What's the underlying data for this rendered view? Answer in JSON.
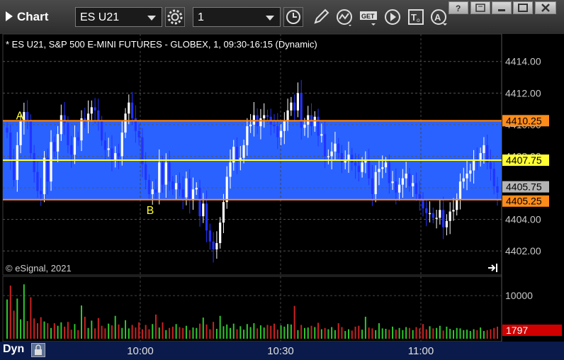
{
  "window": {
    "title": "Chart",
    "symbol": "ES U21",
    "interval": "1"
  },
  "chart_header": "* ES U21, S&P 500 E-MINI FUTURES - GLOBEX, 1, 09:30-16:15 (Dynamic)",
  "copyright": "© eSignal, 2021",
  "footer": {
    "mode_label": "Dyn"
  },
  "icons": {
    "settings": "gear-icon",
    "time": "clock-icon",
    "draw": "pencil-icon",
    "study": "study-line-icon",
    "get": "get-data-icon",
    "play": "play-icon",
    "text": "text-tool-icon",
    "alert": "alert-icon"
  },
  "colors": {
    "band": "#2a62ff",
    "level_line": "#ff8c1a",
    "mid_line": "#ffff33",
    "up_candle": "#ffffff",
    "down_candle": "#2233ff",
    "volume_up": "#2fc62f",
    "volume_down": "#cc2222"
  },
  "chart_data": {
    "type": "candlestick",
    "title": "* ES U21, S&P 500 E-MINI FUTURES - GLOBEX, 1, 09:30-16:15 (Dynamic)",
    "y_axis": {
      "ticks": [
        "4414.00",
        "4412.00",
        "4410.00",
        "4408.00",
        "4406.00",
        "4404.00",
        "4402.00"
      ],
      "range": [
        4401.2,
        4415.2
      ]
    },
    "x_axis": {
      "ticks": [
        "10:00",
        "10:30",
        "11:00"
      ]
    },
    "price_labels": [
      {
        "text": "4410.25",
        "value": 4410.25,
        "color": "#ff8c1a"
      },
      {
        "text": "4407.75",
        "value": 4407.75,
        "color": "#ffff33"
      },
      {
        "text": "4405.75",
        "value": 4405.75,
        "color": "#b4b4b4"
      },
      {
        "text": "4405.25",
        "value": 4405.25,
        "color": "#ff8c1a"
      }
    ],
    "band": {
      "top": 4410.25,
      "bottom": 4405.25,
      "mid": 4407.75
    },
    "annotations": [
      {
        "text": "A",
        "value": 4410.6
      },
      {
        "text": "B",
        "value": 4404.6
      }
    ],
    "last_close": 4405.75,
    "closes": [
      4409.5,
      4407.8,
      4406.5,
      4408.7,
      4410.2,
      4410.8,
      4410.3,
      4408.2,
      4407.0,
      4405.8,
      4405.6,
      4407.9,
      4406.4,
      4408.9,
      4408.3,
      4409.4,
      4410.6,
      4410.1,
      4408.7,
      4408.1,
      4409.2,
      4409.0,
      4410.4,
      4410.2,
      4410.7,
      4411.1,
      4410.9,
      4410.2,
      4409.0,
      4408.4,
      4408.5,
      4407.8,
      4408.2,
      4408.0,
      4409.5,
      4410.7,
      4411.4,
      4410.4,
      4409.6,
      4409.2,
      4407.5,
      4406.5,
      4405.6,
      4405.9,
      4405.7,
      4407.6,
      4406.2,
      4407.6,
      4406.4,
      4405.9,
      4406.3,
      4405.9,
      4405.4,
      4406.6,
      4405.2,
      4405.9,
      4406.0,
      4404.2,
      4405.0,
      4403.3,
      4402.6,
      4402.1,
      4402.5,
      4403.8,
      4405.1,
      4406.7,
      4407.6,
      4408.6,
      4407.7,
      4407.9,
      4408.7,
      4409.9,
      4410.0,
      4410.6,
      4409.9,
      4410.4,
      4410.6,
      4410.5,
      4410.0,
      4409.9,
      4409.2,
      4409.6,
      4410.2,
      4410.9,
      4411.4,
      4410.9,
      4412.0,
      4409.8,
      4410.0,
      4410.6,
      4409.9,
      4410.5,
      4409.3,
      4409.4,
      4408.0,
      4408.0,
      4408.3,
      4408.8,
      4408.2,
      4407.6,
      4407.7,
      4408.1,
      4407.6,
      4407.4,
      4407.0,
      4407.6,
      4407.8,
      4406.6,
      4405.6,
      4407.0,
      4407.2,
      4407.3,
      4407.6,
      4406.3,
      4406.4,
      4405.7,
      4406.2,
      4406.6,
      4406.9,
      4406.1,
      4406.3,
      4405.6,
      4405.3,
      4404.7,
      4404.4,
      4404.4,
      4404.1,
      4404.1,
      4404.6,
      4403.5,
      4403.9,
      4404.5,
      4404.6,
      4405.3,
      4406.4,
      4406.6,
      4406.9,
      4407.1,
      4407.8,
      4407.7,
      4408.2,
      4408.7,
      4407.6,
      4407.2,
      4406.1,
      4405.7
    ],
    "volume": {
      "ticks": [
        "10000"
      ],
      "last": "1797",
      "values": [
        9100,
        12300,
        6500,
        9300,
        4500,
        12600,
        4100,
        9600,
        4700,
        3600,
        5000,
        4000,
        3600,
        2500,
        3600,
        3000,
        3800,
        2800,
        3900,
        2100,
        3400,
        2000,
        7700,
        5100,
        2500,
        4200,
        2400,
        4800,
        3000,
        2400,
        3500,
        3100,
        5300,
        3300,
        2500,
        4300,
        2400,
        3200,
        2600,
        3800,
        2200,
        3200,
        2200,
        3400,
        5600,
        2600,
        3800,
        2000,
        2500,
        2800,
        3400,
        2700,
        2500,
        3000,
        2000,
        2600,
        2500,
        3500,
        4900,
        3300,
        2200,
        3900,
        2300,
        5300,
        2900,
        3300,
        2500,
        3500,
        2200,
        2900,
        2100,
        3400,
        2700,
        3600,
        2400,
        3100,
        2600,
        3200,
        3000,
        3500,
        2100,
        3100,
        2800,
        3400,
        3300,
        7600,
        2000,
        3200,
        2500,
        2600,
        3000,
        2700,
        3700,
        2200,
        2500,
        2200,
        2700,
        2000,
        3600,
        2700,
        1800,
        2200,
        1900,
        2800,
        3000,
        2100,
        5100,
        2600,
        2400,
        2000,
        3600,
        2400,
        2300,
        2100,
        2800,
        2100,
        2500,
        2000,
        2700,
        2500,
        2000,
        2700,
        2400,
        3400,
        2200,
        2900,
        2400,
        2500,
        3000,
        1900,
        2800,
        2300,
        2000,
        2500,
        2400,
        2000,
        2100,
        1800,
        2200,
        2000,
        2600,
        1800,
        2000,
        2200,
        2500,
        2800
      ],
      "range": [
        0,
        12800
      ]
    }
  }
}
